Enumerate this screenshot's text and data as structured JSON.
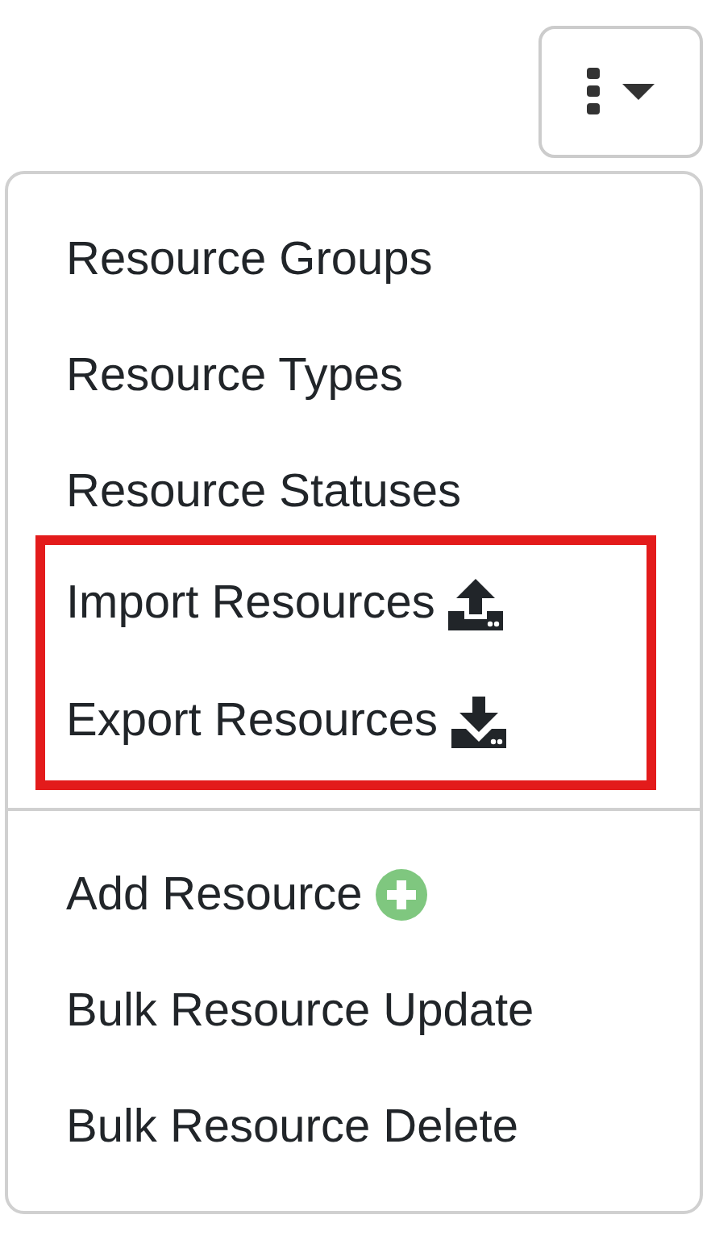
{
  "menu": {
    "groups": [
      {
        "highlighted": false,
        "separated": false,
        "items": [
          {
            "kind": "plain",
            "label": "Resource Groups"
          },
          {
            "kind": "plain",
            "label": "Resource Types"
          },
          {
            "kind": "plain",
            "label": "Resource Statuses"
          }
        ]
      },
      {
        "highlighted": true,
        "separated": false,
        "items": [
          {
            "kind": "upload",
            "label": "Import Resources"
          },
          {
            "kind": "download",
            "label": "Export Resources"
          }
        ]
      },
      {
        "highlighted": false,
        "separated": true,
        "items": [
          {
            "kind": "add",
            "label": "Add Resource"
          },
          {
            "kind": "plain",
            "label": "Bulk Resource Update"
          },
          {
            "kind": "plain",
            "label": "Bulk Resource Delete"
          }
        ]
      }
    ]
  }
}
